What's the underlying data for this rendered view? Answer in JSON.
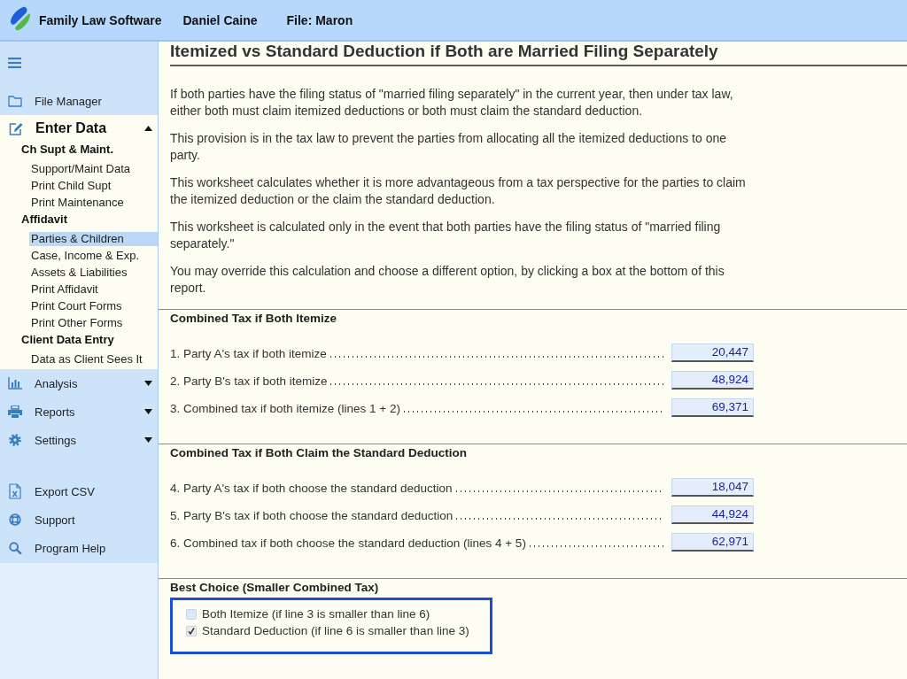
{
  "header": {
    "app_name": "Family Law Software",
    "user": "Daniel Caine",
    "file": "File: Maron"
  },
  "sidebar": {
    "nav": [
      {
        "kind": "link",
        "label": "File Manager"
      },
      {
        "kind": "section",
        "label": "Enter Data",
        "expanded": true,
        "groups": [
          {
            "heading": "Ch Supt & Maint.",
            "items": [
              {
                "label": "Support/Maint Data",
                "selected": false
              },
              {
                "label": "Print Child Supt",
                "selected": false
              },
              {
                "label": "Print Maintenance",
                "selected": false
              }
            ]
          },
          {
            "heading": "Affidavit",
            "items": [
              {
                "label": "Parties & Children",
                "selected": true
              },
              {
                "label": "Case, Income & Exp.",
                "selected": false
              },
              {
                "label": "Assets & Liabilities",
                "selected": false
              },
              {
                "label": "Print Affidavit",
                "selected": false
              },
              {
                "label": "Print Court Forms",
                "selected": false
              },
              {
                "label": "Print Other Forms",
                "selected": false
              }
            ]
          },
          {
            "heading": "Client Data Entry",
            "items": [
              {
                "label": "Data as Client Sees It",
                "selected": false
              }
            ]
          }
        ]
      },
      {
        "kind": "menu",
        "label": "Analysis",
        "expanded": false
      },
      {
        "kind": "menu",
        "label": "Reports",
        "expanded": false
      },
      {
        "kind": "menu",
        "label": "Settings",
        "expanded": false
      }
    ],
    "tools": [
      {
        "label": "Export CSV"
      },
      {
        "label": "Support"
      },
      {
        "label": "Program Help"
      }
    ]
  },
  "report": {
    "title": "Itemized vs Standard Deduction if Both are Married Filing Separately",
    "paragraphs": [
      "If both parties have the filing status of \"married filing separately\" in the current year, then under tax law, either both must claim itemized deductions or both must claim the standard deduction.",
      "This provision is in the tax law to prevent the parties from allocating all the itemized deductions to one party.",
      "This worksheet calculates whether it is more advantageous from a tax perspective for the parties to claim the itemized deduction or the claim the standard deduction.",
      "This worksheet is calculated only in the event that both parties have the filing status of \"married filing separately.\"",
      "You may override this calculation and choose a different option, by clicking a box at the bottom of this report."
    ],
    "sections": [
      {
        "heading": "Combined Tax if Both Itemize",
        "lines": [
          {
            "label": "1. Party A's tax if both itemize",
            "value": "20,447"
          },
          {
            "label": "2. Party B's tax if both itemize",
            "value": "48,924"
          },
          {
            "label": "3. Combined tax if both itemize (lines 1 + 2)",
            "value": "69,371"
          }
        ]
      },
      {
        "heading": "Combined Tax if Both Claim the Standard Deduction",
        "lines": [
          {
            "label": "4. Party A's tax if both choose the standard deduction",
            "value": "18,047"
          },
          {
            "label": "5. Party B's tax if both choose the standard deduction",
            "value": "44,924"
          },
          {
            "label": "6. Combined tax if both choose the standard deduction (lines 4 + 5)",
            "value": "62,971"
          }
        ]
      }
    ],
    "best_choice": {
      "heading": "Best Choice (Smaller Combined Tax)",
      "options": [
        {
          "label": "Both Itemize (if line 3 is smaller than line 6)",
          "checked": false
        },
        {
          "label": "Standard Deduction (if line 6 is smaller than line 3)",
          "checked": true
        }
      ]
    }
  }
}
